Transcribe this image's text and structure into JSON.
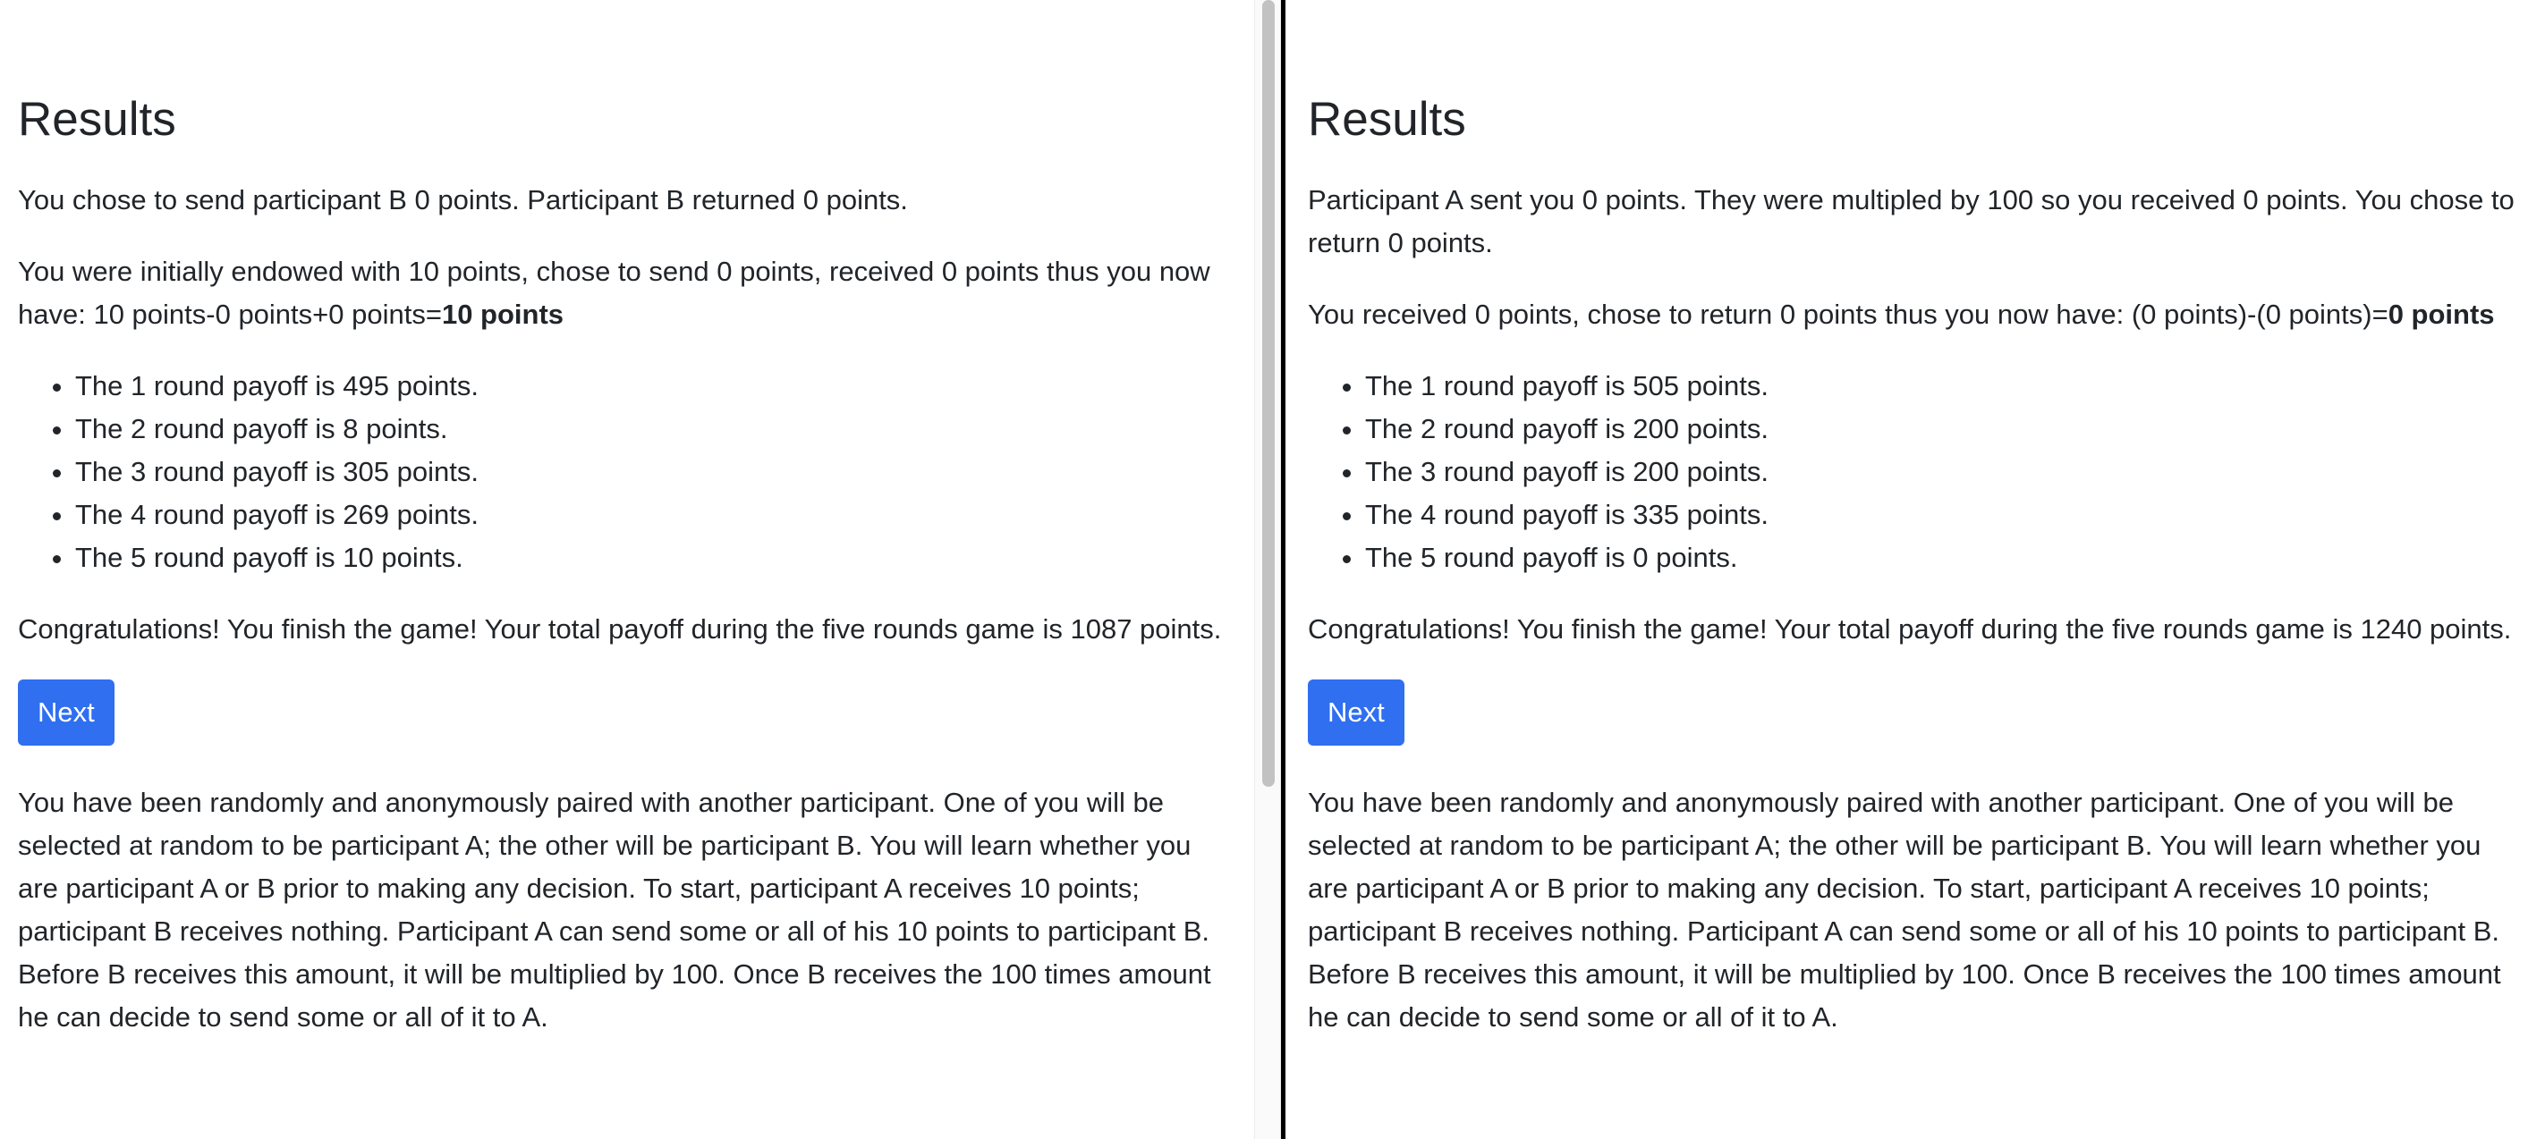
{
  "left": {
    "title": "Results",
    "send_sentence": "You chose to send participant B 0 points. Participant B returned 0 points.",
    "endowment_sentence": "You were initially endowed with 10 points, chose to send 0 points, received 0 points thus you now have: 10 points-0 points+0 points=",
    "endowment_total": "10 points",
    "rounds": [
      "The 1 round payoff is 495 points.",
      "The 2 round payoff is 8 points.",
      "The 3 round payoff is 305 points.",
      "The 4 round payoff is 269 points.",
      "The 5 round payoff is 10 points."
    ],
    "congrats": "Congratulations! You finish the game! Your total payoff during the five rounds game is 1087 points.",
    "next_label": "Next",
    "instructions": "You have been randomly and anonymously paired with another participant. One of you will be selected at random to be participant A; the other will be participant B. You will learn whether you are participant A or B prior to making any decision. To start, participant A receives 10 points; participant B receives nothing. Participant A can send some or all of his 10 points to participant B. Before B receives this amount, it will be multiplied by 100. Once B receives the 100 times amount he can decide to send some or all of it to A."
  },
  "right": {
    "title": "Results",
    "received_sentence": "Participant A sent you 0 points. They were multipled by 100 so you received 0 points. You chose to return 0 points.",
    "balance_sentence": "You received 0 points, chose to return 0 points thus you now have: (0 points)-(0 points)=",
    "balance_total": "0 points",
    "rounds": [
      "The 1 round payoff is 505 points.",
      "The 2 round payoff is 200 points.",
      "The 3 round payoff is 200 points.",
      "The 4 round payoff is 335 points.",
      "The 5 round payoff is 0 points."
    ],
    "congrats": "Congratulations! You finish the game! Your total payoff during the five rounds game is 1240 points.",
    "next_label": "Next",
    "instructions": "You have been randomly and anonymously paired with another participant. One of you will be selected at random to be participant A; the other will be participant B. You will learn whether you are participant A or B prior to making any decision. To start, participant A receives 10 points; participant B receives nothing. Participant A can send some or all of his 10 points to participant B. Before B receives this amount, it will be multiplied by 100. Once B receives the 100 times amount he can decide to send some or all of it to A."
  },
  "colors": {
    "button": "#2f6ff0",
    "text": "#212529",
    "divider": "#000000"
  }
}
